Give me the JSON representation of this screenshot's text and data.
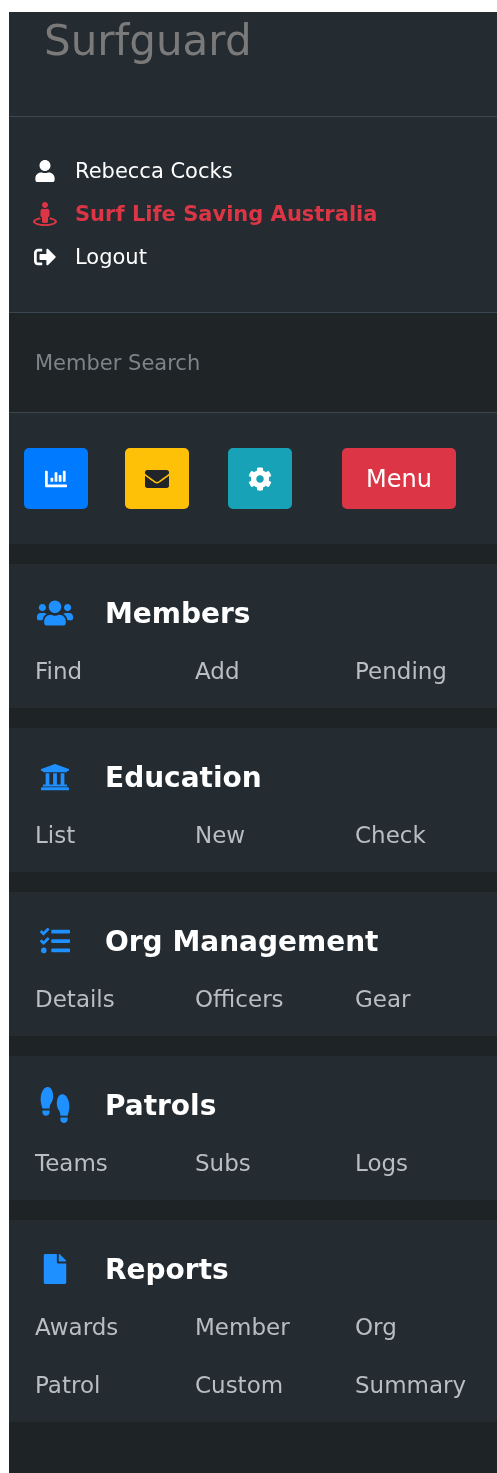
{
  "brand": "Surfguard",
  "user_links": [
    {
      "kind": "user",
      "label": "Rebecca Cocks"
    },
    {
      "kind": "org",
      "label": "Surf Life Saving Australia"
    },
    {
      "kind": "logout",
      "label": "Logout"
    }
  ],
  "search": {
    "placeholder": "Member Search"
  },
  "toolbar": [
    {
      "kind": "stats"
    },
    {
      "kind": "mail"
    },
    {
      "kind": "settings"
    },
    {
      "kind": "menu",
      "label": "Menu"
    }
  ],
  "sections": [
    {
      "kind": "members",
      "title": "Members",
      "links": [
        "Find",
        "Add",
        "Pending"
      ]
    },
    {
      "kind": "education",
      "title": "Education",
      "links": [
        "List",
        "New",
        "Check"
      ]
    },
    {
      "kind": "org",
      "title": "Org Management",
      "links": [
        "Details",
        "Officers",
        "Gear"
      ]
    },
    {
      "kind": "patrols",
      "title": "Patrols",
      "links": [
        "Teams",
        "Subs",
        "Logs"
      ]
    },
    {
      "kind": "reports",
      "title": "Reports",
      "links": [
        "Awards",
        "Member",
        "Org",
        "Patrol",
        "Custom",
        "Summary"
      ]
    }
  ]
}
